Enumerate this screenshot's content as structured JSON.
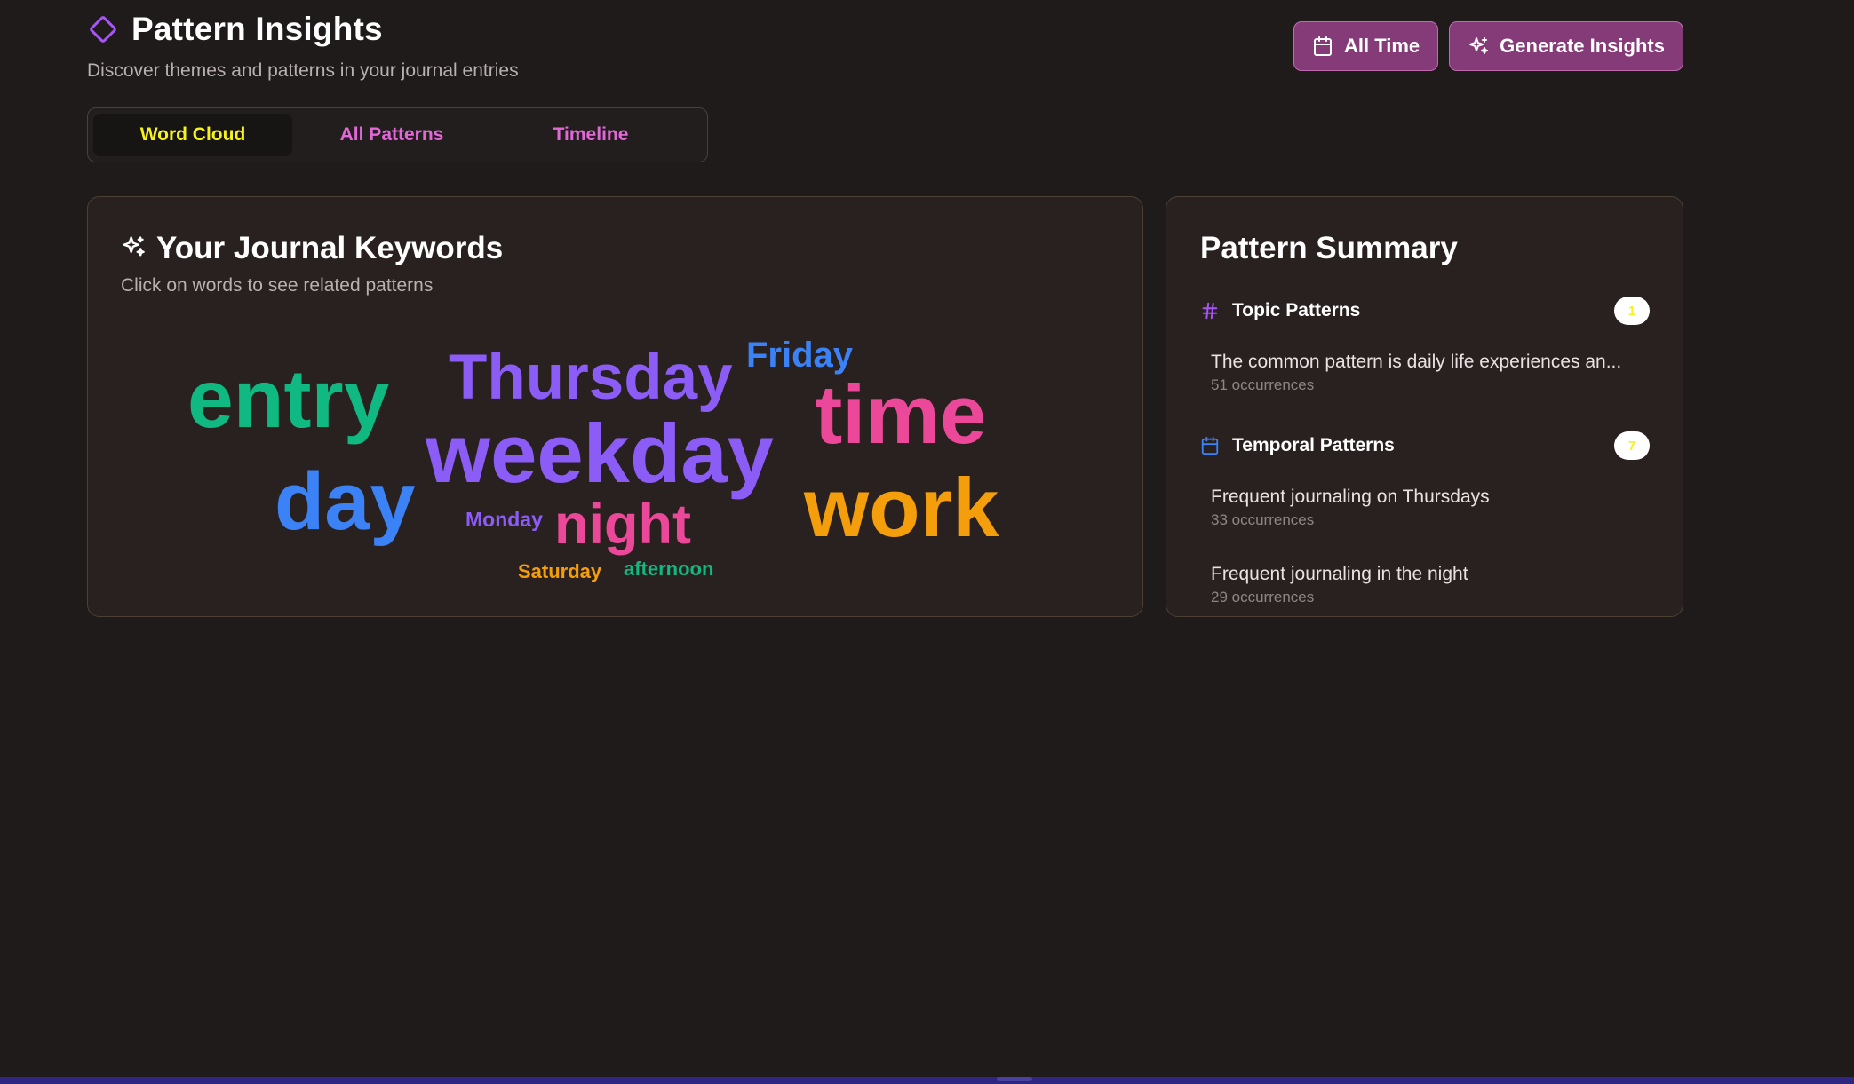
{
  "header": {
    "title": "Pattern Insights",
    "subtitle": "Discover themes and patterns in your journal entries"
  },
  "actions": {
    "all_time_label": "All Time",
    "generate_label": "Generate Insights"
  },
  "tabs": [
    {
      "label": "Word Cloud",
      "active": true
    },
    {
      "label": "All Patterns",
      "active": false
    },
    {
      "label": "Timeline",
      "active": false
    }
  ],
  "keywords": {
    "title": "Your Journal Keywords",
    "subtitle": "Click on words to see related patterns",
    "words": [
      {
        "text": "entry",
        "color": "#10b981"
      },
      {
        "text": "Thursday",
        "color": "#8b5cf6"
      },
      {
        "text": "Friday",
        "color": "#3b82f6"
      },
      {
        "text": "time",
        "color": "#ec4899"
      },
      {
        "text": "weekday",
        "color": "#8b5cf6"
      },
      {
        "text": "day",
        "color": "#3b82f6"
      },
      {
        "text": "Monday",
        "color": "#8b5cf6"
      },
      {
        "text": "night",
        "color": "#ec4899"
      },
      {
        "text": "work",
        "color": "#f59e0b"
      },
      {
        "text": "Saturday",
        "color": "#f59e0b"
      },
      {
        "text": "afternoon",
        "color": "#10b981"
      }
    ]
  },
  "summary": {
    "title": "Pattern Summary",
    "topic": {
      "label": "Topic Patterns",
      "count": "1",
      "items": [
        {
          "text": "The common pattern is daily life experiences an...",
          "occurrences": "51 occurrences"
        }
      ]
    },
    "temporal": {
      "label": "Temporal Patterns",
      "count": "7",
      "items": [
        {
          "text": "Frequent journaling on Thursdays",
          "occurrences": "33 occurrences"
        },
        {
          "text": "Frequent journaling in the night",
          "occurrences": "29 occurrences"
        }
      ]
    }
  },
  "colors": {
    "background": "#1f1b1b",
    "card": "#292120",
    "accent_button": "#863b79",
    "active_tab_text": "#f7f219",
    "tab_text": "#e268d8"
  }
}
